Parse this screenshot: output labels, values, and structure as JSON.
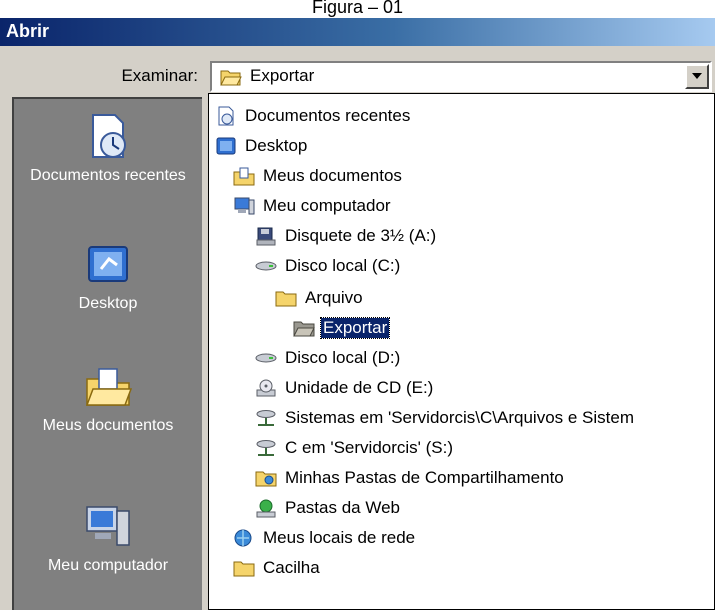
{
  "caption": "Figura – 01",
  "window": {
    "title": "Abrir"
  },
  "lookin": {
    "label": "Examinar:",
    "selected": "Exportar"
  },
  "places": [
    {
      "label": "Documentos recentes",
      "icon": "recent-documents-icon"
    },
    {
      "label": "Desktop",
      "icon": "desktop-icon"
    },
    {
      "label": "Meus documentos",
      "icon": "my-documents-icon"
    },
    {
      "label": "Meu computador",
      "icon": "my-computer-icon"
    }
  ],
  "dropdown": {
    "items": [
      {
        "label": "Documentos recentes",
        "icon": "recent-documents-icon",
        "level": 0
      },
      {
        "label": "Desktop",
        "icon": "desktop-icon",
        "level": 0
      },
      {
        "label": "Meus documentos",
        "icon": "my-documents-icon",
        "level": 1
      },
      {
        "label": "Meu computador",
        "icon": "my-computer-icon",
        "level": 1
      },
      {
        "label": "Disquete de 3½ (A:)",
        "icon": "floppy-drive-icon",
        "level": 2
      },
      {
        "label": "Disco local (C:)",
        "icon": "hard-disk-icon",
        "level": 2
      },
      {
        "label": "Arquivo",
        "icon": "folder-icon",
        "level": 3
      },
      {
        "label": "Exportar",
        "icon": "open-folder-icon",
        "level": 4,
        "selected": true
      },
      {
        "label": "Disco local (D:)",
        "icon": "hard-disk-icon",
        "level": 2
      },
      {
        "label": "Unidade de CD (E:)",
        "icon": "cd-drive-icon",
        "level": 2
      },
      {
        "label": "Sistemas em 'Servidorcis\\C\\Arquivos e Sistem",
        "icon": "network-drive-icon",
        "level": 2
      },
      {
        "label": "C em 'Servidorcis' (S:)",
        "icon": "network-drive-icon",
        "level": 2
      },
      {
        "label": "Minhas Pastas de Compartilhamento",
        "icon": "shared-folders-icon",
        "level": 2
      },
      {
        "label": "Pastas da Web",
        "icon": "web-folders-icon",
        "level": 2
      },
      {
        "label": "Meus locais de rede",
        "icon": "network-places-icon",
        "level": 1
      },
      {
        "label": "Cacilha",
        "icon": "folder-icon",
        "level": 1
      }
    ]
  },
  "colors": {
    "titlebar_start": "#0a246a",
    "titlebar_end": "#a6caf0",
    "dialog_face": "#d4d0c8",
    "places_bar": "#808080",
    "selection": "#0a246a",
    "folder": "#f5d46b"
  }
}
